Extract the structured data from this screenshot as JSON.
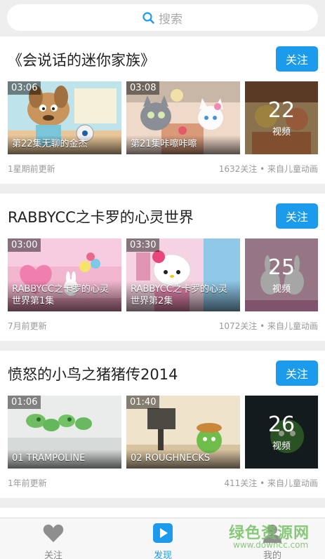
{
  "search": {
    "placeholder": "搜索"
  },
  "channels": [
    {
      "title": "《会说话的迷你家族》",
      "follow_label": "关注",
      "videos": [
        {
          "duration": "03:06",
          "caption": "第22集无聊的金杰"
        },
        {
          "duration": "03:08",
          "caption": "第21集咔嚓咔嚓"
        }
      ],
      "more_count": "22",
      "more_label": "视频",
      "updated": "1星期前更新",
      "stats": "1632关注 • 来自儿童动画"
    },
    {
      "title": "RABBYCC之卡罗的心灵世界",
      "follow_label": "关注",
      "videos": [
        {
          "duration": "03:00",
          "caption": "RABBYCC之卡罗的心灵世界第1集"
        },
        {
          "duration": "03:30",
          "caption": "RABBYCC之卡罗的心灵世界第2集"
        }
      ],
      "more_count": "25",
      "more_label": "视频",
      "updated": "7月前更新",
      "stats": "1072关注 • 来自儿童动画"
    },
    {
      "title": "愤怒的小鸟之猪猪传2014",
      "follow_label": "关注",
      "videos": [
        {
          "duration": "01:06",
          "caption": "01 TRAMPOLINE"
        },
        {
          "duration": "01:40",
          "caption": "02 ROUGHNECKS"
        }
      ],
      "more_count": "26",
      "more_label": "视频",
      "updated": "1年前更新",
      "stats": "411关注 • 来自儿童动画"
    }
  ],
  "nav": {
    "follow": "关注",
    "discover": "发现",
    "mine": "我的"
  },
  "watermark": {
    "text": "绿色资源网",
    "url": "www.downcc.com"
  },
  "colors": {
    "accent": "#1c9bec",
    "background": "#eeeeee"
  }
}
